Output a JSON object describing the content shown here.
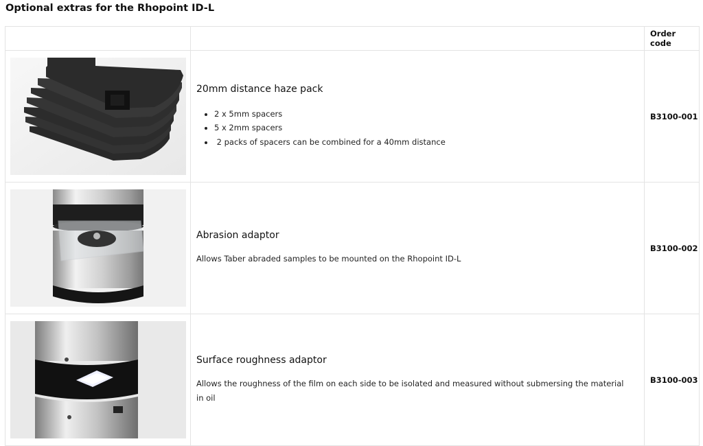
{
  "page": {
    "title": "Optional extras for the Rhopoint ID-L"
  },
  "table": {
    "header": {
      "order_code": "Order code"
    },
    "rows": [
      {
        "title": "20mm distance haze pack",
        "bullets": [
          "2 x 5mm spacers",
          "5 x 2mm spacers",
          " 2 packs of spacers can be combined for a 40mm distance"
        ],
        "code": "B3100-001",
        "image": "haze-spacers-photo"
      },
      {
        "title": "Abrasion adaptor",
        "text": "Allows Taber abraded samples to be mounted on the Rhopoint ID-L",
        "code": "B3100-002",
        "image": "abrasion-adaptor-photo"
      },
      {
        "title": "Surface roughness adaptor",
        "text": "Allows the roughness of the film on each side to be isolated and measured without submersing the material in oil",
        "code": "B3100-003",
        "image": "roughness-adaptor-photo"
      }
    ]
  }
}
